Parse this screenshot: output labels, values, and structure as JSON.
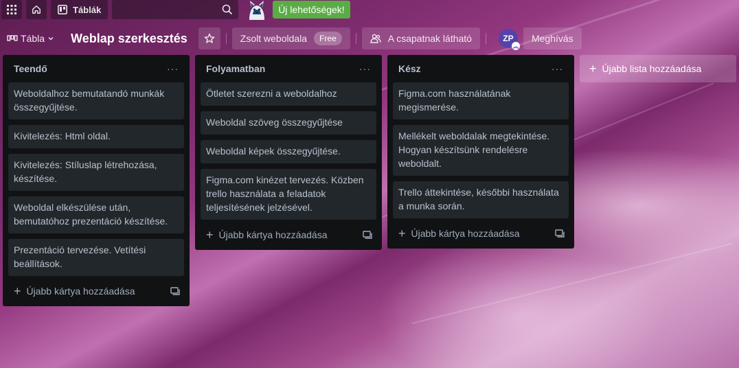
{
  "topnav": {
    "boards_label": "Táblák",
    "new_opportunities_label": "Új lehetőségek!",
    "icons": [
      "apps-grid-icon",
      "home-icon",
      "boards-icon",
      "search-icon"
    ]
  },
  "board_header": {
    "view_label": "Tábla",
    "title": "Weblap szerkesztés",
    "workspace_label": "Zsolt weboldala",
    "workspace_badge": "Free",
    "visibility_label": "A csapatnak látható",
    "avatar_initials": "ZP",
    "invite_label": "Meghívás"
  },
  "lists": [
    {
      "title": "Teendő",
      "cards": [
        "Weboldalhoz bemutatandó munkák összegyűjtése.",
        "Kivitelezés: Html oldal.",
        "Kivitelezés: Stíluslap létrehozása, készítése.",
        "Weboldal elkészülése után, bemutatóhoz prezentáció készítése.",
        "Prezentáció tervezése. Vetítési beállítások."
      ],
      "add_card_label": "Újabb kártya hozzáadása"
    },
    {
      "title": "Folyamatban",
      "cards": [
        "Ötletet szerezni a weboldalhoz",
        "Weboldal szöveg összegyűjtése",
        "Weboldal képek összegyűjtése.",
        "Figma.com kinézet tervezés. Közben trello használata a feladatok teljesítésének jelzésével."
      ],
      "add_card_label": "Újabb kártya hozzáadása"
    },
    {
      "title": "Kész",
      "cards": [
        "Figma.com használatának megismerése.",
        "Mellékelt weboldalak megtekintése. Hogyan készítsünk rendelésre weboldalt.",
        "Trello áttekintése, későbbi használata a munka során."
      ],
      "add_card_label": "Újabb kártya hozzáadása"
    }
  ],
  "add_list_label": "Újabb lista hozzáadása",
  "colors": {
    "list_bg": "#111214",
    "card_bg": "#22272b",
    "text": "#b6c2cf",
    "new_opps_green": "#5aac44",
    "avatar": "#5243aa"
  }
}
